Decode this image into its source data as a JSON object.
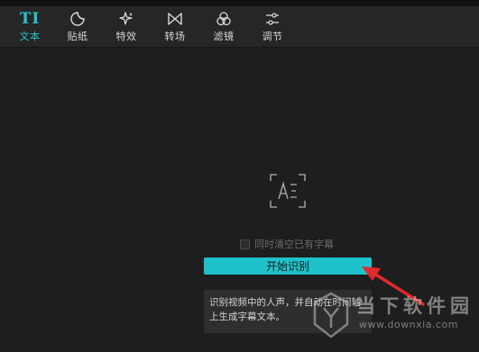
{
  "toolbar": {
    "tabs": [
      {
        "label": "文本",
        "icon": "text-ti-icon",
        "active": true
      },
      {
        "label": "贴纸",
        "icon": "sticker-icon",
        "active": false
      },
      {
        "label": "特效",
        "icon": "sparkle-effect-icon",
        "active": false
      },
      {
        "label": "转场",
        "icon": "transition-bowtie-icon",
        "active": false
      },
      {
        "label": "滤镜",
        "icon": "filter-circles-icon",
        "active": false
      },
      {
        "label": "调节",
        "icon": "adjust-sliders-icon",
        "active": false
      }
    ],
    "text_glyph": "TI"
  },
  "panel": {
    "checkbox_label": "同时清空已有字幕",
    "checkbox_checked": false,
    "start_button": "开始识别",
    "hint_text": "识别视频中的人声，并自动在时间轴上生成字幕文本。"
  },
  "watermark": {
    "title": "当下软件园",
    "url": "www.downxia.com"
  },
  "colors": {
    "accent": "#1fc2ca",
    "background": "#1e1e1e",
    "toolbar": "#262626",
    "arrow": "#e02a2a"
  }
}
